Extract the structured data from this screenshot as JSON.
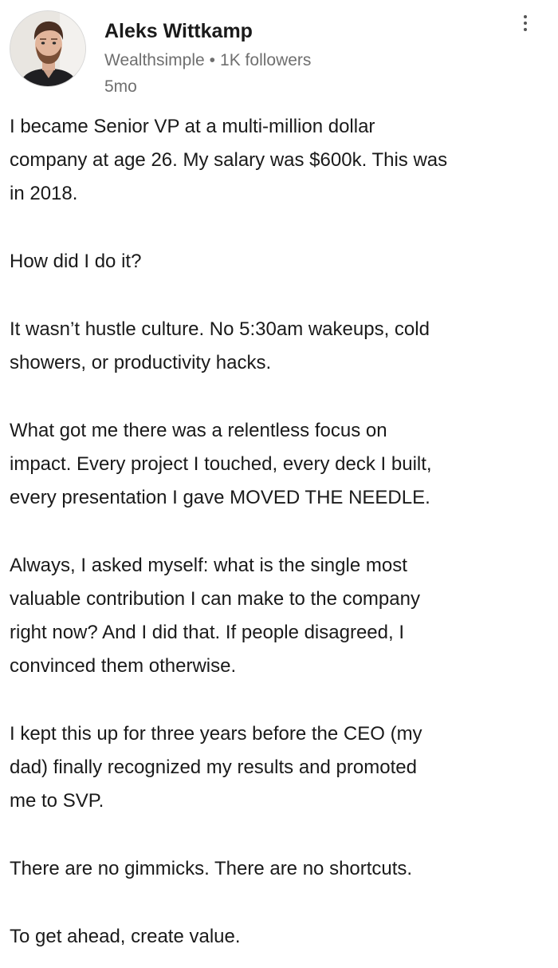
{
  "post": {
    "author": {
      "name": "Aleks Wittkamp",
      "company": "Wealthsimple",
      "separator": "•",
      "followers": "1K followers",
      "time": "5mo",
      "avatar_icon": "person-avatar"
    },
    "more_icon": "more-vertical-icon",
    "paragraphs": [
      "I became Senior VP at a multi-million dollar\ncompany at age 26. My salary was $600k. This was\nin 2018.",
      "How did I do it?",
      "It wasn’t hustle culture. No 5:30am wakeups, cold\nshowers, or productivity hacks.",
      "What got me there was a relentless focus on\nimpact. Every project I touched, every deck I built,\nevery presentation I gave MOVED THE NEEDLE.",
      "Always, I asked myself: what is the single most\nvaluable contribution I can make to the company\nright now? And I did that. If people disagreed, I\nconvinced them otherwise.",
      "I kept this up for three years before the CEO (my\ndad) finally recognized my results and promoted\nme to SVP.",
      "There are no gimmicks. There are no shortcuts.",
      "To get ahead, create value."
    ]
  }
}
